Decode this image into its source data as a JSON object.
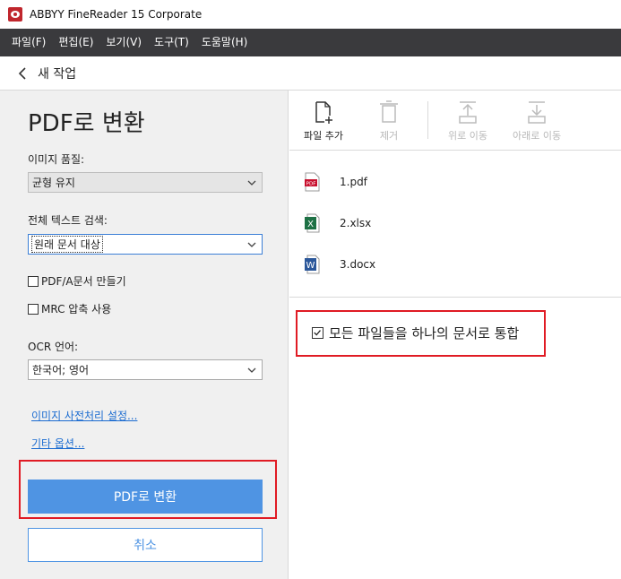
{
  "titlebar": {
    "title": "ABBYY FineReader 15 Corporate"
  },
  "menu": [
    "파일(F)",
    "편집(E)",
    "보기(V)",
    "도구(T)",
    "도움말(H)"
  ],
  "nav": {
    "back_label": "새 작업"
  },
  "left": {
    "title": "PDF로 변환",
    "image_quality_label": "이미지 품질:",
    "image_quality_value": "균형 유지",
    "fulltext_label": "전체 텍스트 검색:",
    "fulltext_value": "원래 문서 대상",
    "pdfa_label": "PDF/A문서 만들기",
    "mrc_label": "MRC 압축 사용",
    "ocr_label": "OCR 언어:",
    "ocr_value": "한국어; 영어",
    "preprocess_link": "이미지 사전처리 설정...",
    "other_link": "기타 옵션...",
    "convert_button": "PDF로 변환",
    "cancel_button": "취소"
  },
  "toolbar": {
    "add": "파일 추가",
    "remove": "제거",
    "up": "위로 이동",
    "down": "아래로 이동"
  },
  "files": [
    {
      "name": "1.pdf",
      "type": "pdf",
      "badge": "PDF",
      "color": "#c8102e"
    },
    {
      "name": "2.xlsx",
      "type": "xlsx",
      "badge": "X",
      "color": "#1e7145"
    },
    {
      "name": "3.docx",
      "type": "docx",
      "badge": "W",
      "color": "#2b579a"
    }
  ],
  "merge": {
    "label": "모든 파일들을 하나의 문서로 통합",
    "checked": true
  },
  "colors": {
    "accent": "#4f94e3",
    "highlight": "#e01b24",
    "menubar": "#3a3a3d"
  }
}
